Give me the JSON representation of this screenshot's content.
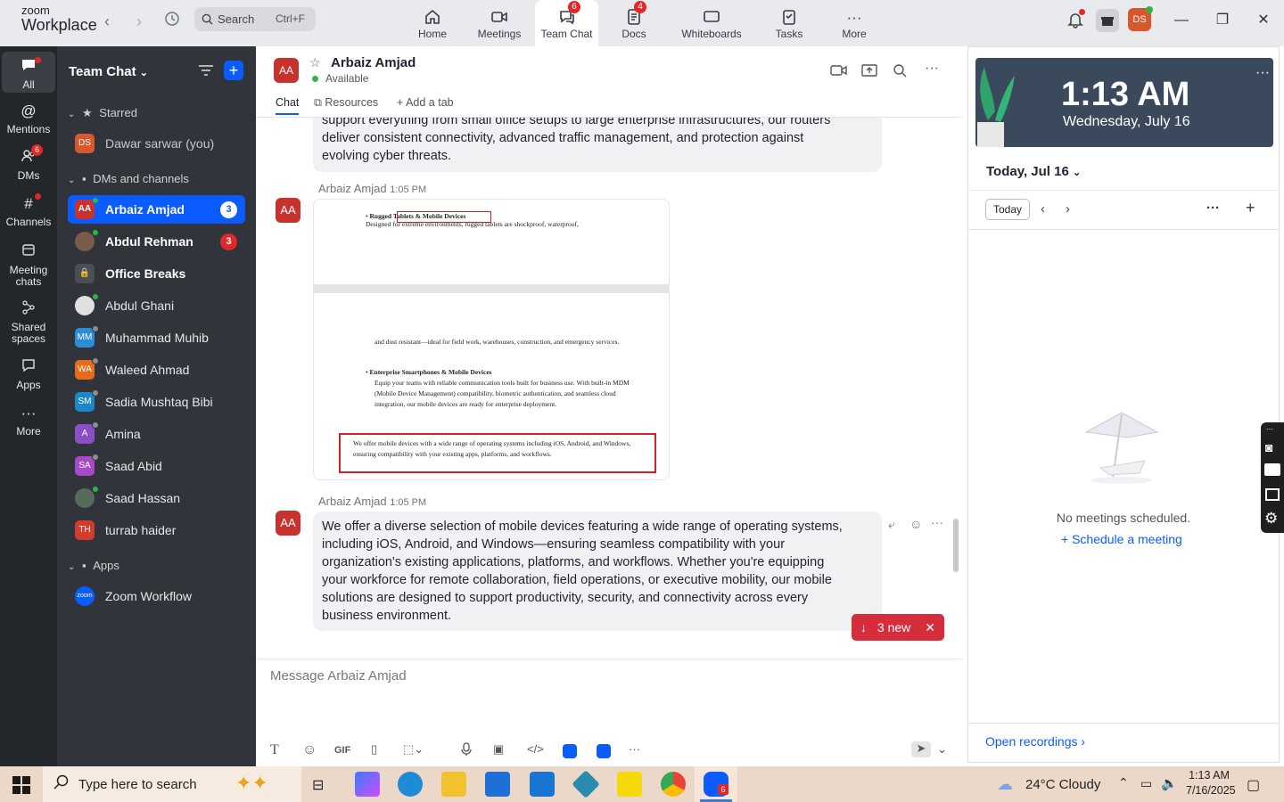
{
  "topbar": {
    "brand_top": "zoom",
    "brand_bottom": "Workplace",
    "search_label": "Search",
    "search_shortcut": "Ctrl+F",
    "nav": [
      {
        "label": "Home",
        "icon": "home-icon"
      },
      {
        "label": "Meetings",
        "icon": "video-icon"
      },
      {
        "label": "Team Chat",
        "icon": "chat-icon",
        "badge": "6"
      },
      {
        "label": "Docs",
        "icon": "doc-icon",
        "badge": "4"
      },
      {
        "label": "Whiteboards",
        "icon": "whiteboard-icon"
      },
      {
        "label": "Tasks",
        "icon": "tasks-icon"
      },
      {
        "label": "More",
        "icon": "more-icon"
      }
    ],
    "avatar": "DS"
  },
  "rail": [
    {
      "label": "All"
    },
    {
      "label": "Mentions"
    },
    {
      "label": "DMs",
      "badge": "6"
    },
    {
      "label": "Channels"
    },
    {
      "label": "Meeting chats"
    },
    {
      "label": "Shared spaces"
    },
    {
      "label": "Apps"
    },
    {
      "label": "More"
    }
  ],
  "sidebar": {
    "title": "Team Chat",
    "sections": {
      "starred": "Starred",
      "dms": "DMs and channels",
      "apps": "Apps"
    },
    "starred": [
      {
        "name": "Dawar sarwar (you)",
        "initials": "DS",
        "color": "#d9582b"
      }
    ],
    "items": [
      {
        "name": "Arbaiz Amjad",
        "initials": "AA",
        "color": "#c8322c",
        "count": "3"
      },
      {
        "name": "Abdul Rehman",
        "initials": "",
        "color": "#7a5a4a",
        "count": "3"
      },
      {
        "name": "Office Breaks",
        "initials": "",
        "color": "#4a4e55"
      },
      {
        "name": "Abdul Ghani",
        "initials": "",
        "color": "#e0e0e0"
      },
      {
        "name": "Muhammad Muhib",
        "initials": "MM",
        "color": "#2d8cd6"
      },
      {
        "name": "Waleed Ahmad",
        "initials": "WA",
        "color": "#e86a1c"
      },
      {
        "name": "Sadia Mushtaq Bibi",
        "initials": "SM",
        "color": "#1e88c7"
      },
      {
        "name": "Amina",
        "initials": "A",
        "color": "#8a4fc4"
      },
      {
        "name": "Saad Abid",
        "initials": "SA",
        "color": "#a74ac9"
      },
      {
        "name": "Saad Hassan",
        "initials": "",
        "color": "#5a6a5a"
      },
      {
        "name": "turrab haider",
        "initials": "TH",
        "color": "#d33b2c"
      }
    ],
    "apps": [
      {
        "name": "Zoom Workflow",
        "initials": "zoom",
        "color": "#0b5cff"
      }
    ]
  },
  "chat": {
    "contact": "Arbaiz Amjad",
    "initials": "AA",
    "status": "Available",
    "tabs": [
      "Chat",
      "Resources",
      "Add a tab"
    ],
    "msg1_lines": [
      "support everything from small office setups to large enterprise infrastructures, our routers",
      "deliver consistent connectivity, advanced traffic management, and protection against",
      "evolving cyber threats."
    ],
    "msg2_sender": "Arbaiz Amjad",
    "msg2_time": "1:05 PM",
    "doc": {
      "bullet1_bold": "Rugged Tablets & Mobile Devices",
      "bullet1_text": "Designed for extreme environments, rugged tablets are shockproof, waterproof,",
      "para1": "and dust resistant—ideal for field work, warehouses, construction, and emergency services.",
      "bullet2_bold": "Enterprise Smartphones & Mobile Devices",
      "bullet2_text": "Equip your teams with reliable communication tools built for business use. With built-in MDM (Mobile Device Management) compatibility, biometric authentication, and seamless cloud integration, our mobile devices are ready for enterprise deployment.",
      "boxed": "We offer mobile devices with a wide range of operating systems including iOS, Android, and Windows, ensuring compatibility with your existing apps, platforms, and workflows."
    },
    "msg3_sender": "Arbaiz Amjad",
    "msg3_time": "1:05 PM",
    "msg3_lines": [
      "We offer a diverse selection of mobile devices featuring a wide range of operating systems,",
      "including iOS, Android, and Windows—ensuring seamless compatibility with your",
      "organization's existing applications, platforms, and workflows. Whether you're equipping",
      "your workforce for remote collaboration, field operations, or executive mobility, our mobile",
      "solutions are designed to support productivity, security, and connectivity across every",
      "business environment."
    ],
    "new_label": "3 new",
    "composer_placeholder": "Message Arbaiz Amjad",
    "toolbar": [
      "T",
      "☺",
      "GIF"
    ]
  },
  "calendar": {
    "time": "1:13 AM",
    "date": "Wednesday, July 16",
    "today_heading": "Today, Jul 16",
    "today_button": "Today",
    "empty": "No meetings scheduled.",
    "schedule": "Schedule a meeting",
    "recordings": "Open recordings"
  },
  "taskbar": {
    "search_placeholder": "Type here to search",
    "weather": "24°C  Cloudy",
    "time": "1:13 AM",
    "date": "7/16/2025",
    "zoom_badge": "6"
  }
}
